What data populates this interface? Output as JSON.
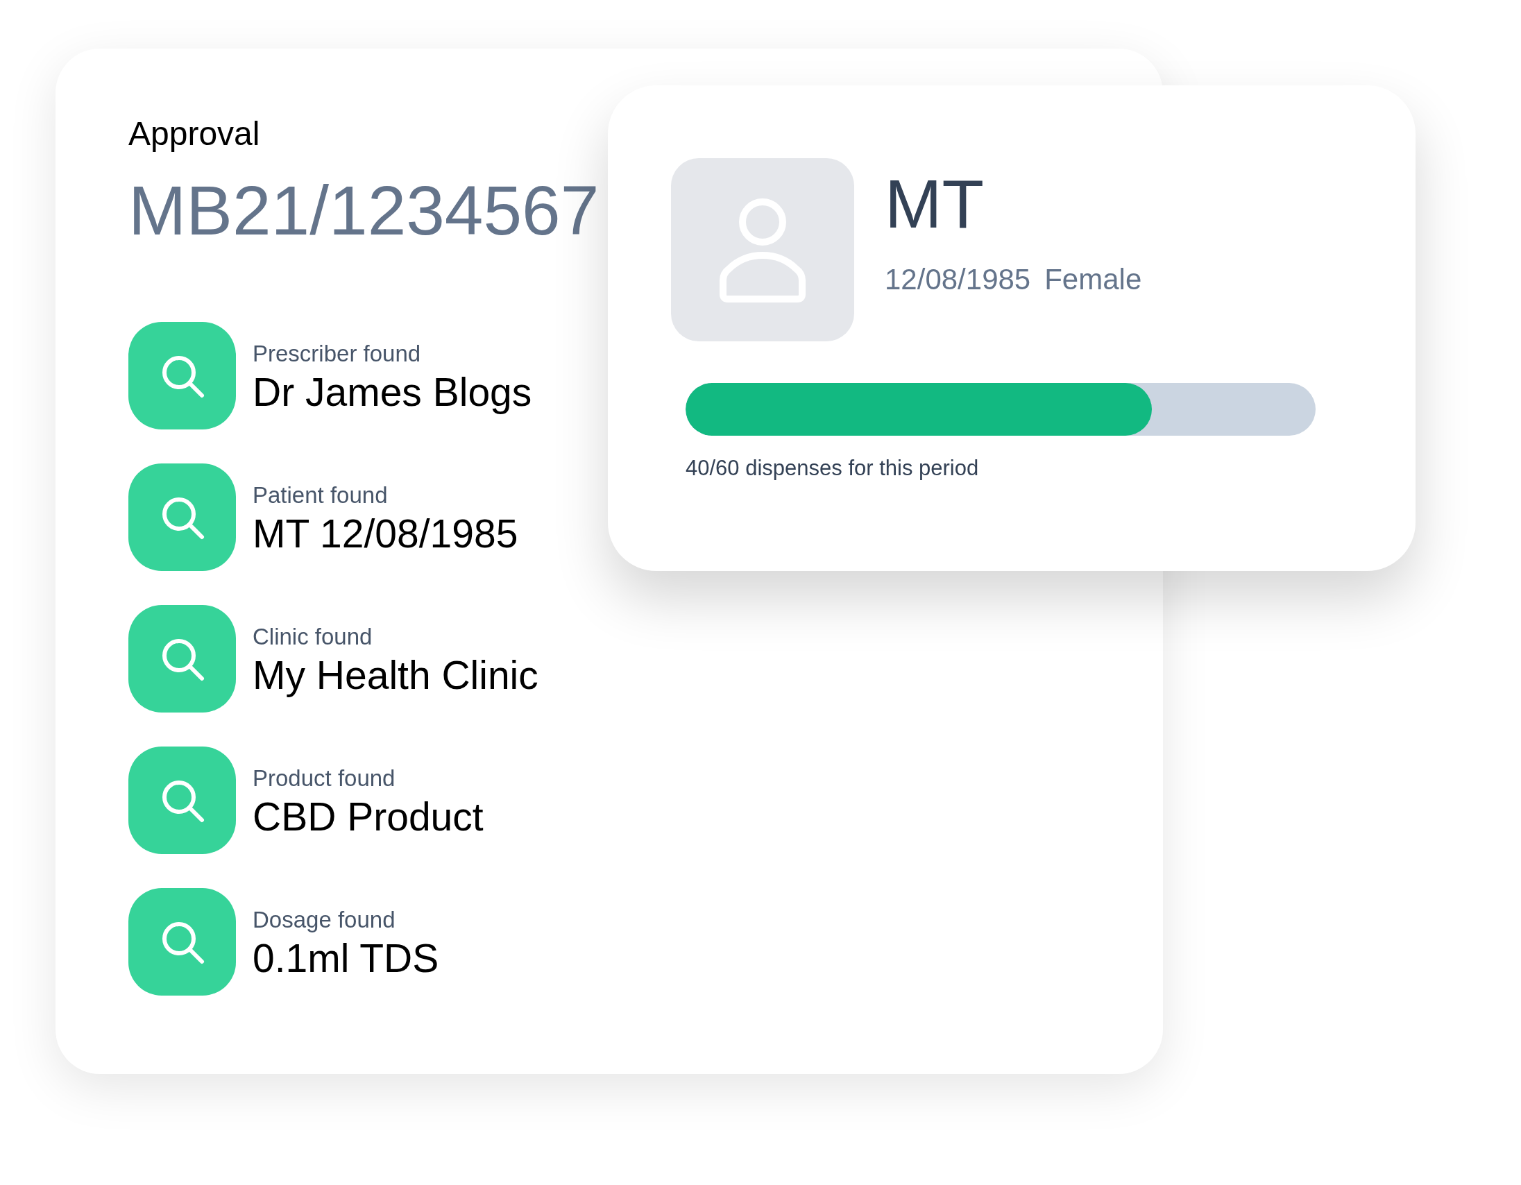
{
  "approval": {
    "title": "Approval",
    "number": "MB21/1234567"
  },
  "findings": [
    {
      "label": "Prescriber found",
      "value": "Dr James Blogs"
    },
    {
      "label": "Patient found",
      "value": "MT 12/08/1985"
    },
    {
      "label": "Clinic found",
      "value": "My Health Clinic"
    },
    {
      "label": "Product found",
      "value": "CBD Product"
    },
    {
      "label": "Dosage found",
      "value": "0.1ml TDS"
    }
  ],
  "patient": {
    "initials": "MT",
    "dob": "12/08/1985",
    "sex": "Female",
    "dispenses": {
      "level": 0.74,
      "caption": "40/60 dispenses for this period"
    }
  }
}
